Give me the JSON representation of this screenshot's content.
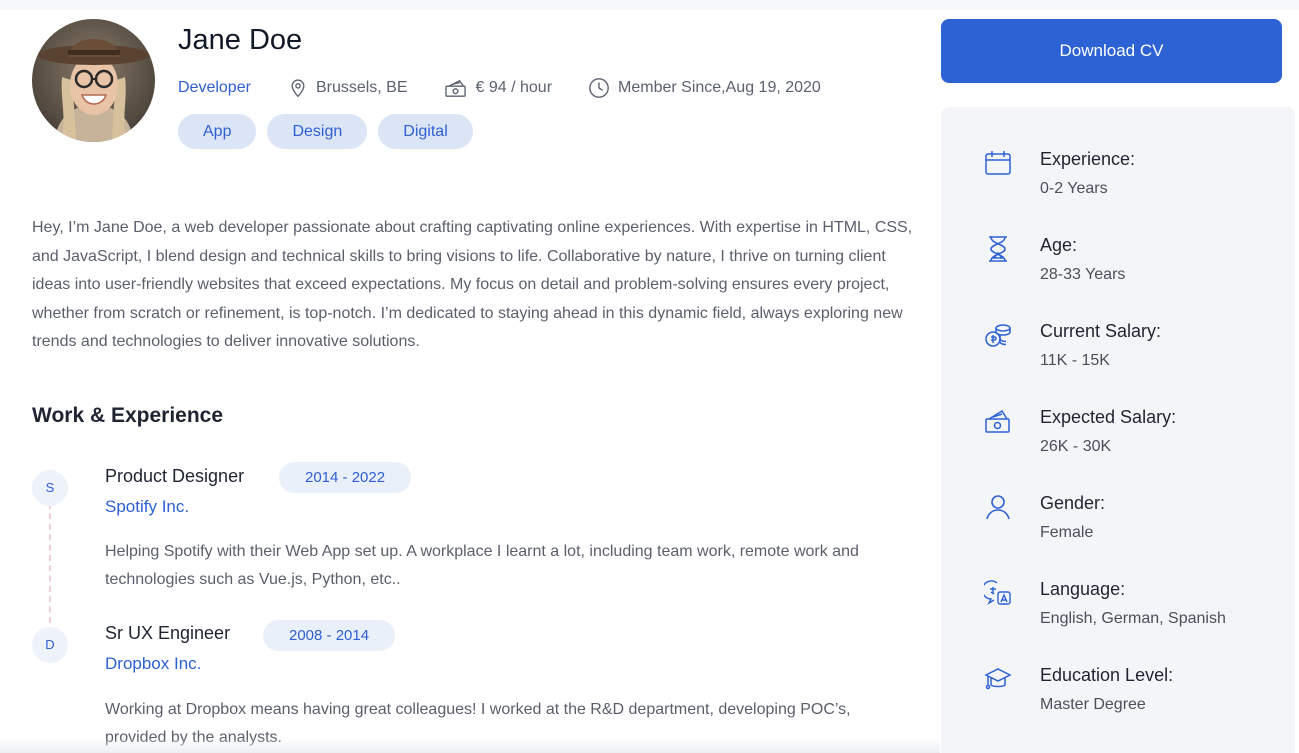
{
  "profile": {
    "name": "Jane Doe",
    "role": "Developer",
    "location": "Brussels, BE",
    "rate": "€ 94 / hour",
    "member_since": "Member Since,Aug 19, 2020",
    "tags": [
      "App",
      "Design",
      "Digital"
    ]
  },
  "about": "Hey, I’m Jane Doe, a web developer passionate about crafting captivating online experiences. With expertise in HTML, CSS, and JavaScript, I blend design and technical skills to bring visions to life. Collaborative by nature, I thrive on turning client ideas into user-friendly websites that exceed expectations. My focus on detail and problem-solving ensures every project, whether from scratch or refinement, is top-notch. I’m dedicated to staying ahead in this dynamic field, always exploring new trends and technologies to deliver innovative solutions.",
  "work": {
    "title": "Work & Experience",
    "jobs": [
      {
        "initial": "S",
        "title": "Product Designer",
        "years": "2014 - 2022",
        "company": "Spotify Inc.",
        "description": "Helping Spotify with their Web App set up. A workplace I learnt a lot, including team work, remote work and technologies such as Vue.js, Python, etc.."
      },
      {
        "initial": "D",
        "title": "Sr UX Engineer",
        "years": "2008 - 2014",
        "company": "Dropbox Inc.",
        "description": "Working at Dropbox means having great colleagues! I worked at the R&D department, developing POC’s, provided by the analysts."
      }
    ]
  },
  "sidebar": {
    "download_label": "Download CV",
    "items": [
      {
        "icon": "calendar-icon",
        "label": "Experience:",
        "value": "0-2 Years"
      },
      {
        "icon": "hourglass-icon",
        "label": "Age:",
        "value": "28-33 Years"
      },
      {
        "icon": "coins-icon",
        "label": "Current Salary:",
        "value": "11K - 15K"
      },
      {
        "icon": "money-icon",
        "label": "Expected Salary:",
        "value": "26K - 30K"
      },
      {
        "icon": "user-icon",
        "label": "Gender:",
        "value": "Female"
      },
      {
        "icon": "language-icon",
        "label": "Language:",
        "value": "English, German, Spanish"
      },
      {
        "icon": "graduation-cap-icon",
        "label": "Education Level:",
        "value": "Master Degree"
      }
    ]
  },
  "colors": {
    "accent": "#2d62d4",
    "tag_bg": "#dbe5f6",
    "panel_bg": "#f4f5f8",
    "timeline_line": "#f3cfd8"
  }
}
